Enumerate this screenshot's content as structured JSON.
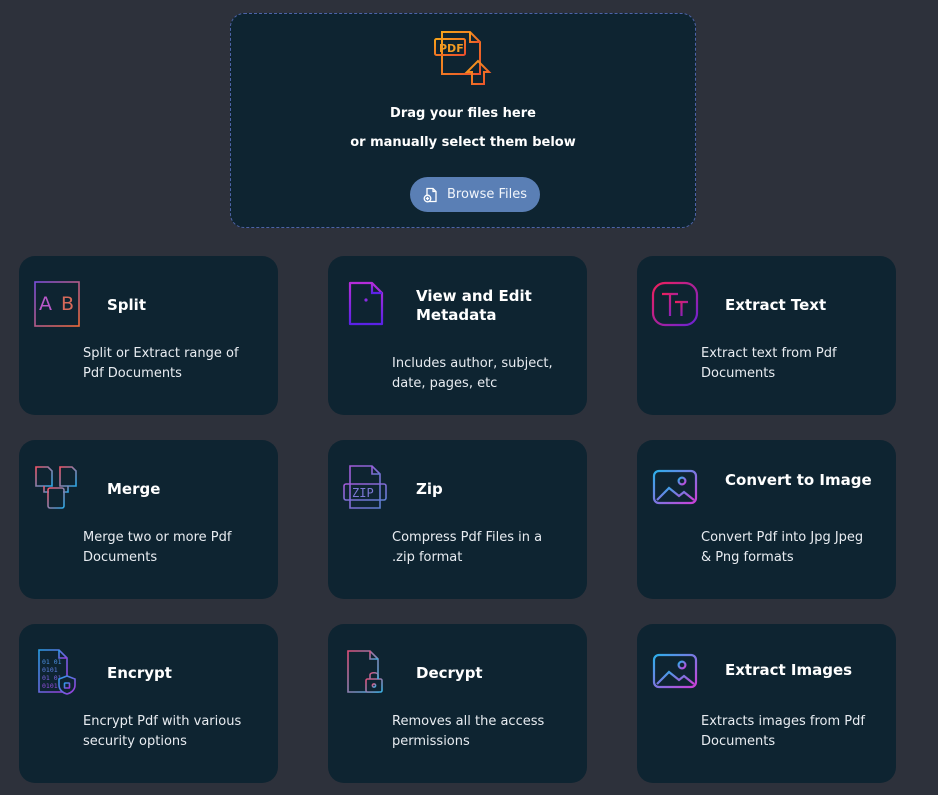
{
  "upload": {
    "title": "Drag your files here",
    "subtitle": "or manually select them below",
    "browse_label": "Browse Files"
  },
  "tools": [
    {
      "title": "Split",
      "desc": "Split or Extract range of Pdf Documents"
    },
    {
      "title": "View and Edit Metadata",
      "desc": "Includes author, subject, date, pages, etc"
    },
    {
      "title": "Extract Text",
      "desc": "Extract text from Pdf Documents"
    },
    {
      "title": "Merge",
      "desc": "Merge two or more Pdf Documents"
    },
    {
      "title": "Zip",
      "desc": "Compress Pdf Files in a .zip format"
    },
    {
      "title": "Convert to Image",
      "desc": "Convert Pdf into Jpg Jpeg & Png formats"
    },
    {
      "title": "Encrypt",
      "desc": "Encrypt Pdf with various security options"
    },
    {
      "title": "Decrypt",
      "desc": "Removes all the access permissions"
    },
    {
      "title": "Extract Images",
      "desc": "Extracts images from Pdf Documents"
    }
  ],
  "icons": {
    "upload": "pdf-upload-icon",
    "browse": "file-add-icon",
    "split": "split-ab-icon",
    "metadata": "info-document-icon",
    "extract_text": "text-tt-icon",
    "merge": "merge-files-icon",
    "zip": "zip-file-icon",
    "convert": "image-icon",
    "encrypt": "binary-file-shield-icon",
    "decrypt": "document-lock-icon",
    "extract_images": "image-icon"
  },
  "colors": {
    "background": "#2d313b",
    "card": "#0e2431",
    "button": "#5a7fb5",
    "accent_orange": "#f08a24",
    "accent_purple": "#8b2be2"
  }
}
